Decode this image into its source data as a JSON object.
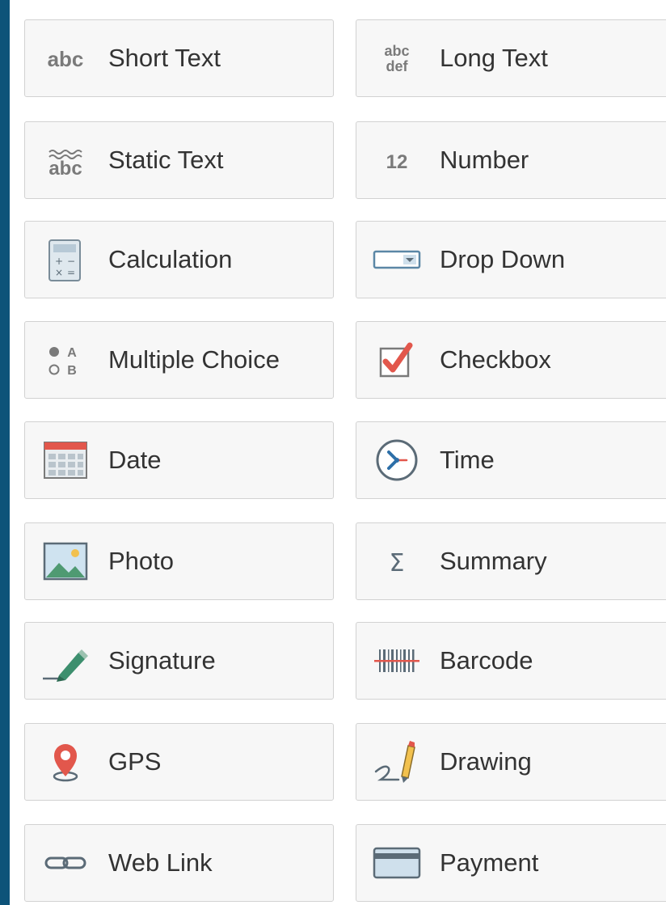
{
  "fields": {
    "short_text": "Short Text",
    "long_text": "Long Text",
    "static_text": "Static Text",
    "number": "Number",
    "calculation": "Calculation",
    "drop_down": "Drop Down",
    "multiple_choice": "Multiple Choice",
    "checkbox": "Checkbox",
    "date": "Date",
    "time": "Time",
    "photo": "Photo",
    "summary": "Summary",
    "signature": "Signature",
    "barcode": "Barcode",
    "gps": "GPS",
    "drawing": "Drawing",
    "web_link": "Web Link",
    "payment": "Payment"
  },
  "icon_text": {
    "abc": "abc",
    "def": "def",
    "twelve": "12",
    "a": "A",
    "b": "B",
    "sigma": "Σ"
  },
  "icons": {
    "short_text": "abc-text-icon",
    "long_text": "abc-def-icon",
    "static_text": "static-abc-icon",
    "number": "number-12-icon",
    "calculation": "calculator-icon",
    "drop_down": "dropdown-icon",
    "multiple_choice": "radio-ab-icon",
    "checkbox": "checkbox-checked-icon",
    "date": "calendar-icon",
    "time": "clock-icon",
    "photo": "image-icon",
    "summary": "sigma-icon",
    "signature": "pen-signature-icon",
    "barcode": "barcode-icon",
    "gps": "location-pin-icon",
    "drawing": "pencil-squiggle-icon",
    "web_link": "link-icon",
    "payment": "credit-card-icon"
  },
  "colors": {
    "background": "#0d5379",
    "tile": "#f7f7f7",
    "tile_border": "#d2d2d2",
    "label": "#333333",
    "icon_gray": "#7a7a7a",
    "accent_red": "#e2574c",
    "icon_blue": "#5b87a6",
    "icon_light_blue": "#cfe0ec",
    "pen_green": "#3d8f6e"
  }
}
